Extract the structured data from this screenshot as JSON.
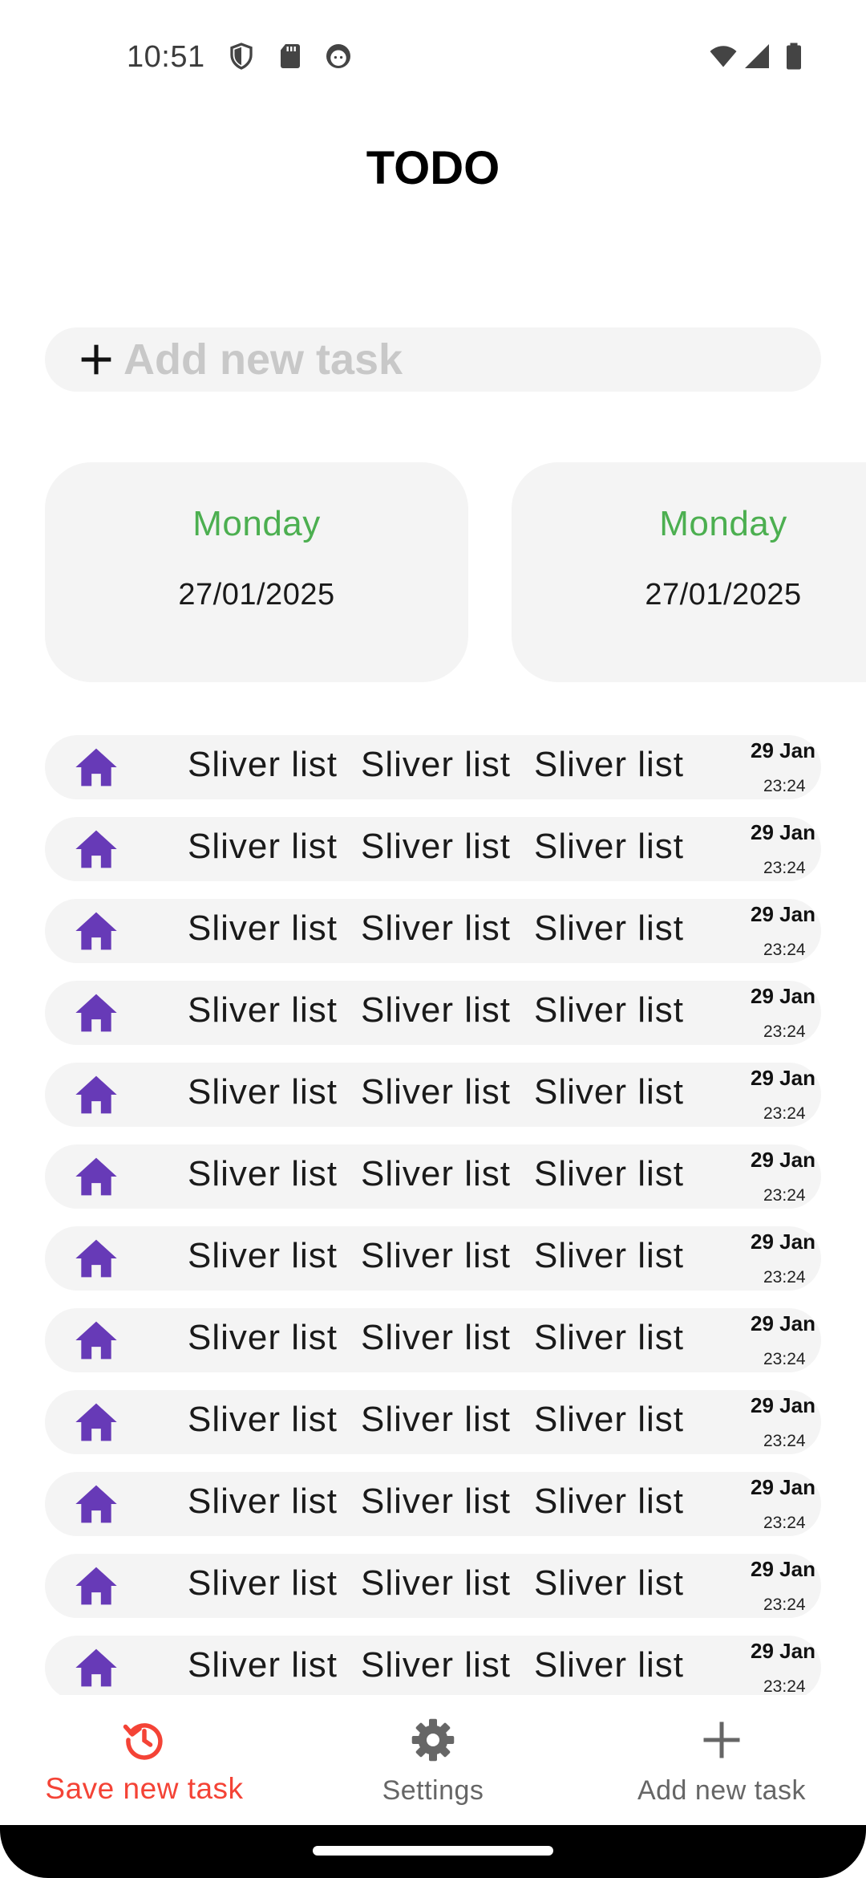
{
  "status_bar": {
    "time": "10:51",
    "left_icons": [
      "shield-icon",
      "sd-card-icon",
      "face-icon"
    ],
    "right_icons": [
      "wifi-icon",
      "signal-icon",
      "battery-icon"
    ]
  },
  "header": {
    "title": "TODO"
  },
  "add_task": {
    "placeholder": "Add new task",
    "icon": "plus-icon"
  },
  "date_cards": [
    {
      "day": "Monday",
      "date": "27/01/2025"
    },
    {
      "day": "Monday",
      "date": "27/01/2025"
    }
  ],
  "tasks": [
    {
      "icon": "home-icon",
      "texts": [
        "Sliver list",
        "Sliver list",
        "Sliver list"
      ],
      "date": "29 Jan",
      "time": "23:24"
    },
    {
      "icon": "home-icon",
      "texts": [
        "Sliver list",
        "Sliver list",
        "Sliver list"
      ],
      "date": "29 Jan",
      "time": "23:24"
    },
    {
      "icon": "home-icon",
      "texts": [
        "Sliver list",
        "Sliver list",
        "Sliver list"
      ],
      "date": "29 Jan",
      "time": "23:24"
    },
    {
      "icon": "home-icon",
      "texts": [
        "Sliver list",
        "Sliver list",
        "Sliver list"
      ],
      "date": "29 Jan",
      "time": "23:24"
    },
    {
      "icon": "home-icon",
      "texts": [
        "Sliver list",
        "Sliver list",
        "Sliver list"
      ],
      "date": "29 Jan",
      "time": "23:24"
    },
    {
      "icon": "home-icon",
      "texts": [
        "Sliver list",
        "Sliver list",
        "Sliver list"
      ],
      "date": "29 Jan",
      "time": "23:24"
    },
    {
      "icon": "home-icon",
      "texts": [
        "Sliver list",
        "Sliver list",
        "Sliver list"
      ],
      "date": "29 Jan",
      "time": "23:24"
    },
    {
      "icon": "home-icon",
      "texts": [
        "Sliver list",
        "Sliver list",
        "Sliver list"
      ],
      "date": "29 Jan",
      "time": "23:24"
    },
    {
      "icon": "home-icon",
      "texts": [
        "Sliver list",
        "Sliver list",
        "Sliver list"
      ],
      "date": "29 Jan",
      "time": "23:24"
    },
    {
      "icon": "home-icon",
      "texts": [
        "Sliver list",
        "Sliver list",
        "Sliver list"
      ],
      "date": "29 Jan",
      "time": "23:24"
    },
    {
      "icon": "home-icon",
      "texts": [
        "Sliver list",
        "Sliver list",
        "Sliver list"
      ],
      "date": "29 Jan",
      "time": "23:24"
    },
    {
      "icon": "home-icon",
      "texts": [
        "Sliver list",
        "Sliver list",
        "Sliver list"
      ],
      "date": "29 Jan",
      "time": "23:24"
    }
  ],
  "bottom_nav": [
    {
      "label": "Save new task",
      "icon": "history-icon",
      "active": true
    },
    {
      "label": "Settings",
      "icon": "gear-icon",
      "active": false
    },
    {
      "label": "Add new task",
      "icon": "plus-icon",
      "active": false
    }
  ],
  "colors": {
    "accent_active": "#f44336",
    "day_green": "#4caf50",
    "home_icon": "#673ab7",
    "surface": "#f4f4f4"
  }
}
